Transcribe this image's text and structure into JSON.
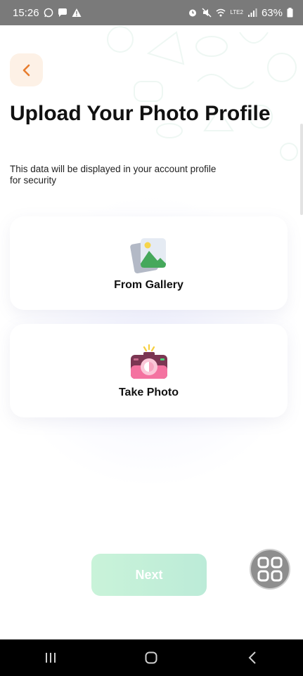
{
  "status_bar": {
    "time": "15:26",
    "battery": "63%",
    "network_label": "LTE2",
    "icons": [
      "whatsapp-icon",
      "chat-icon",
      "warning-icon",
      "alarm-icon",
      "mute-icon",
      "wifi-icon",
      "signal-icon",
      "battery-icon"
    ]
  },
  "header": {
    "back_icon": "chevron-left-icon",
    "title": "Upload Your Photo Profile",
    "subtitle": "This data will be displayed in your account profile for security"
  },
  "options": [
    {
      "label": "From Gallery",
      "icon": "gallery-icon"
    },
    {
      "label": "Take Photo",
      "icon": "camera-icon"
    }
  ],
  "footer": {
    "next_label": "Next",
    "assist_icon": "grid-icon"
  },
  "navigation_bar": {
    "icons": [
      "recents-icon",
      "home-icon",
      "back-icon"
    ]
  },
  "colors": {
    "accent": "#e87d2e",
    "back_button_bg": "#fdf1e6",
    "next_button": "#c9f3d9",
    "title": "#111111"
  }
}
